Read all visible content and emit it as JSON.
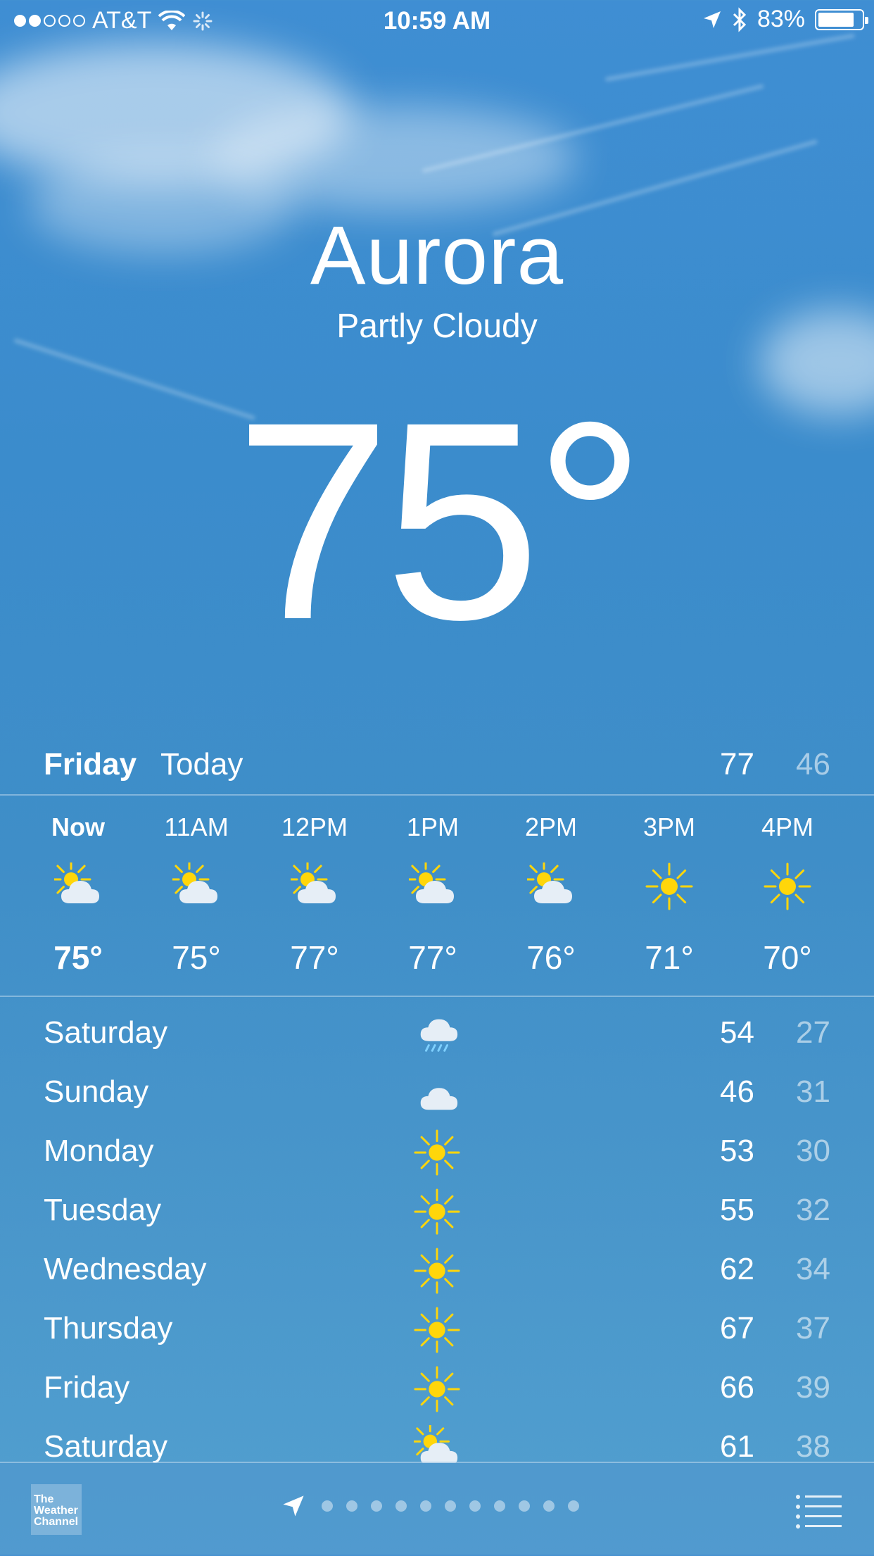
{
  "status_bar": {
    "carrier": "AT&T",
    "time": "10:59 AM",
    "battery": "83%",
    "battery_level": 0.83
  },
  "location": {
    "city": "Aurora",
    "condition": "Partly Cloudy",
    "temperature": "75°"
  },
  "today": {
    "day": "Friday",
    "label": "Today",
    "high": "77",
    "low": "46"
  },
  "hourly": [
    {
      "time": "Now",
      "icon": "partly-cloudy-icon",
      "temp": "75°"
    },
    {
      "time": "11AM",
      "icon": "partly-cloudy-icon",
      "temp": "75°"
    },
    {
      "time": "12PM",
      "icon": "partly-cloudy-icon",
      "temp": "77°"
    },
    {
      "time": "1PM",
      "icon": "partly-cloudy-icon",
      "temp": "77°"
    },
    {
      "time": "2PM",
      "icon": "partly-cloudy-icon",
      "temp": "76°"
    },
    {
      "time": "3PM",
      "icon": "sun-icon",
      "temp": "71°"
    },
    {
      "time": "4PM",
      "icon": "sun-icon",
      "temp": "70°"
    }
  ],
  "daily": [
    {
      "day": "Saturday",
      "icon": "rain-cloud-icon",
      "high": "54",
      "low": "27"
    },
    {
      "day": "Sunday",
      "icon": "cloud-icon",
      "high": "46",
      "low": "31"
    },
    {
      "day": "Monday",
      "icon": "sun-icon",
      "high": "53",
      "low": "30"
    },
    {
      "day": "Tuesday",
      "icon": "sun-icon",
      "high": "55",
      "low": "32"
    },
    {
      "day": "Wednesday",
      "icon": "sun-icon",
      "high": "62",
      "low": "34"
    },
    {
      "day": "Thursday",
      "icon": "sun-icon",
      "high": "67",
      "low": "37"
    },
    {
      "day": "Friday",
      "icon": "sun-icon",
      "high": "66",
      "low": "39"
    },
    {
      "day": "Saturday",
      "icon": "partly-cloudy-icon",
      "high": "61",
      "low": "38"
    }
  ],
  "bottom_bar": {
    "logo_text": "The Weather Channel",
    "page_count": 11,
    "current_page": 0
  }
}
